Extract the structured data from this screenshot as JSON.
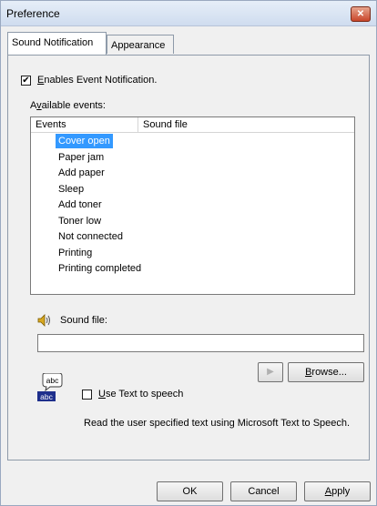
{
  "window": {
    "title": "Preference",
    "close_symbol": "✕"
  },
  "tabs": [
    {
      "label": "Sound Notification",
      "active": true
    },
    {
      "label": "Appearance",
      "active": false
    }
  ],
  "enable_notification": {
    "checked": true,
    "check_mark": "✔",
    "label_accel": "E",
    "label_rest": "nables Event Notification."
  },
  "available_events": {
    "label_pre": "A",
    "label_accel": "v",
    "label_rest": "ailable events:"
  },
  "events_list": {
    "columns": [
      "Events",
      "Sound file"
    ],
    "rows": [
      {
        "event": "Cover open",
        "sound_file": "",
        "selected": true
      },
      {
        "event": "Paper jam",
        "sound_file": ""
      },
      {
        "event": "Add paper",
        "sound_file": ""
      },
      {
        "event": "Sleep",
        "sound_file": ""
      },
      {
        "event": "Add toner",
        "sound_file": ""
      },
      {
        "event": "Toner low",
        "sound_file": ""
      },
      {
        "event": "Not connected",
        "sound_file": ""
      },
      {
        "event": "Printing",
        "sound_file": ""
      },
      {
        "event": "Printing completed",
        "sound_file": ""
      }
    ]
  },
  "sound_file": {
    "label": "Sound file:",
    "value": "",
    "icon": "speaker-icon"
  },
  "buttons": {
    "play_symbol": "▶",
    "browse_accel": "B",
    "browse_rest": "rowse...",
    "ok": "OK",
    "cancel": "Cancel",
    "apply_accel": "A",
    "apply_rest": "pply"
  },
  "tts": {
    "icon": "text-to-speech-icon",
    "icon_text_top": "abc",
    "icon_text_bottom": "abc",
    "checked": false,
    "label_accel": "U",
    "label_rest": "se Text to speech",
    "description": "Read the user specified text using Microsoft Text to Speech."
  }
}
